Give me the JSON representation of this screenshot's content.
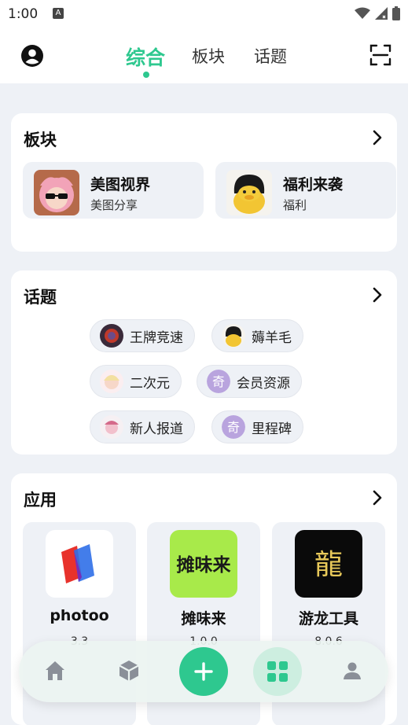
{
  "status_bar": {
    "time": "1:00",
    "a_badge": "A"
  },
  "header": {
    "tabs": [
      {
        "label": "综合",
        "active": true
      },
      {
        "label": "板块",
        "active": false
      },
      {
        "label": "话题",
        "active": false
      }
    ],
    "accent_color": "#2ec88f"
  },
  "boards": {
    "title": "板块",
    "items": [
      {
        "name": "美图视界",
        "desc": "美图分享"
      },
      {
        "name": "福利来袭",
        "desc": "福利"
      }
    ]
  },
  "topics": {
    "title": "话题",
    "items": [
      {
        "label": "王牌竞速"
      },
      {
        "label": "薅羊毛"
      },
      {
        "label": "二次元"
      },
      {
        "label": "会员资源",
        "icon_text": "奇"
      },
      {
        "label": "新人报道"
      },
      {
        "label": "里程碑",
        "icon_text": "奇"
      }
    ]
  },
  "apps": {
    "title": "应用",
    "items": [
      {
        "name": "photoo",
        "version": "3.3"
      },
      {
        "name": "摊味来",
        "icon_text": "摊味来",
        "version": "1.0.0"
      },
      {
        "name": "游龙工具",
        "icon_text": "龍",
        "version": "8.0.6"
      }
    ]
  },
  "bottom_nav": {
    "items": [
      "home-icon",
      "cube-icon",
      "plus-icon",
      "grid-icon",
      "person-icon"
    ]
  }
}
